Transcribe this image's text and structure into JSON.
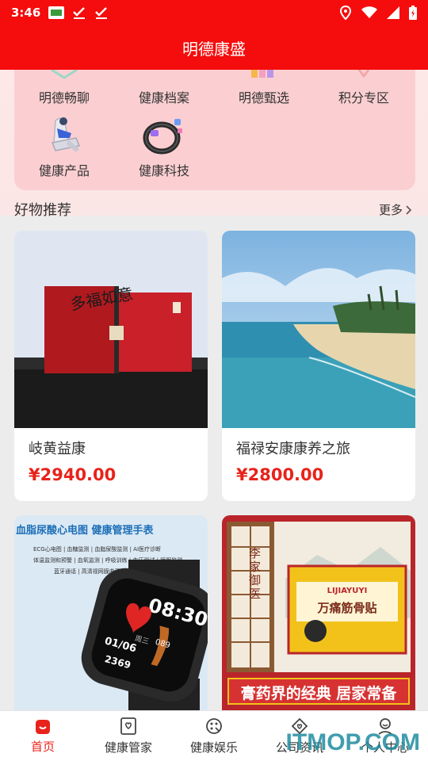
{
  "status_bar": {
    "time": "3:46"
  },
  "app_title": "明德康盛",
  "categories": [
    {
      "label": "明德畅聊",
      "icon": "chat-icon"
    },
    {
      "label": "健康档案",
      "icon": "health-record-icon"
    },
    {
      "label": "明德甄选",
      "icon": "selection-icon"
    },
    {
      "label": "积分专区",
      "icon": "points-icon"
    },
    {
      "label": "健康产品",
      "icon": "massage-chair-icon"
    },
    {
      "label": "健康科技",
      "icon": "smart-ring-icon"
    }
  ],
  "section": {
    "title": "好物推荐",
    "more": "更多"
  },
  "products": [
    {
      "name": "岐黄益康",
      "price": "¥2940.00",
      "image_text": "多福如意"
    },
    {
      "name": "福禄安康康养之旅",
      "price": "¥2800.00"
    },
    {
      "image_title": "血脂尿酸心电图 健康管理手表",
      "image_features": [
        "ECG心电图 | 血糖监测 | 血脂尿酸监测 | AI医疗诊断",
        "体温监测和预警 | 血氧监测 | 呼吸训练 | 血压测试 | 睡眠监测",
        "蓝牙通话 | 高清视网膜曲面屏"
      ],
      "watch_time": "08:30",
      "watch_date": "01/06",
      "watch_day": "周三",
      "watch_bpm": "089",
      "watch_steps": "2369"
    },
    {
      "image_title": "李家御医",
      "image_product": "万痛筋骨贴",
      "image_brand": "LIJIAYUYI",
      "image_slogan": "膏药界的经典 居家常备"
    }
  ],
  "bottom_nav": [
    {
      "label": "首页",
      "icon": "home-icon",
      "active": true
    },
    {
      "label": "健康管家",
      "icon": "heart-card-icon",
      "active": false
    },
    {
      "label": "健康娱乐",
      "icon": "entertainment-icon",
      "active": false
    },
    {
      "label": "公司资讯",
      "icon": "news-icon",
      "active": false
    },
    {
      "label": "个人中心",
      "icon": "user-icon",
      "active": false
    }
  ],
  "watermark": "ITMOP.COM",
  "colors": {
    "brand": "#f50c0c",
    "price": "#e8231b"
  }
}
